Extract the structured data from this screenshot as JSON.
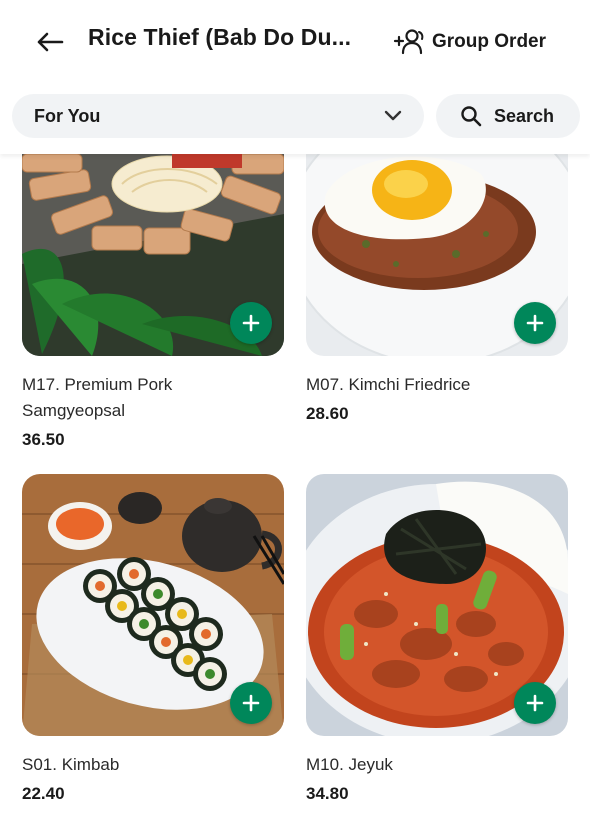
{
  "header": {
    "title": "Rice Thief (Bab Do Du...",
    "group_order_label": "Group Order"
  },
  "filter": {
    "category_selected": "For You",
    "search_label": "Search"
  },
  "menu_items": [
    {
      "name": "M17. Premium Pork Samgyeopsal",
      "price": "36.50"
    },
    {
      "name": "M07. Kimchi Friedrice",
      "price": "28.60"
    },
    {
      "name": "S01. Kimbab",
      "price": "22.40"
    },
    {
      "name": "M10. Jeyuk",
      "price": "34.80"
    }
  ],
  "colors": {
    "accent": "#00875a",
    "chip_bg": "#f1f3f5"
  }
}
